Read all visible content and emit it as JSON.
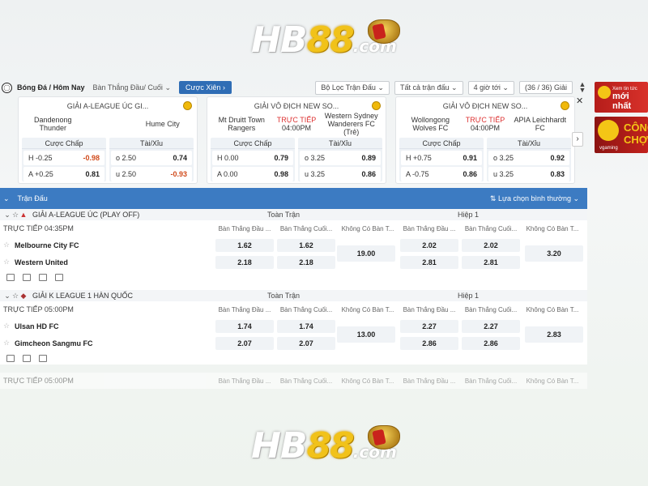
{
  "logo": {
    "hb": "HB",
    "n88": "88",
    "com": ".com"
  },
  "filterbar": {
    "breadcrumb": "Bóng Đá / Hôm Nay",
    "market_select": "Bàn Thắng Đầu/ Cuối",
    "xien_button": "Cược Xiên",
    "match_filter": "Bộ Lọc Trận Đấu",
    "all_matches": "Tất cả trận đấu",
    "time_filter": "4 giờ tới",
    "count": "(36 / 36) Giải"
  },
  "cards": [
    {
      "league": "GIẢI A-LEAGUE ÚC GI...",
      "home": "Dandenong Thunder",
      "away": "Hume City",
      "live": "",
      "time": "",
      "handicap_header": "Cược Chấp",
      "ou_header": "Tài/Xỉu",
      "h_line": "-0.25",
      "h_odd": "-0.98",
      "h_odd_neg": true,
      "a_line": "+0.25",
      "a_odd": "0.81",
      "a_odd_neg": false,
      "o_line": "2.50",
      "o_odd": "0.74",
      "o_odd_neg": false,
      "u_line": "2.50",
      "u_odd": "-0.93",
      "u_odd_neg": true
    },
    {
      "league": "GIẢI VÔ ĐỊCH NEW SO...",
      "home": "Mt Druitt Town Rangers",
      "away": "Western Sydney Wanderers FC (Trẻ)",
      "live": "TRỰC TIẾP",
      "time": "04:00PM",
      "handicap_header": "Cược Chấp",
      "ou_header": "Tài/Xỉu",
      "h_line": "0.00",
      "h_odd": "0.79",
      "h_odd_neg": false,
      "a_line": "0.00",
      "a_odd": "0.98",
      "a_odd_neg": false,
      "o_line": "3.25",
      "o_odd": "0.89",
      "o_odd_neg": false,
      "u_line": "3.25",
      "u_odd": "0.86",
      "u_odd_neg": false
    },
    {
      "league": "GIẢI VÔ ĐỊCH NEW SO...",
      "home": "Wollongong Wolves FC",
      "away": "APIA Leichhardt FC",
      "live": "TRỰC TIẾP",
      "time": "04:00PM",
      "handicap_header": "Cược Chấp",
      "ou_header": "Tài/Xỉu",
      "h_line": "+0.75",
      "h_odd": "0.91",
      "h_odd_neg": false,
      "a_line": "-0.75",
      "a_odd": "0.86",
      "a_odd_neg": false,
      "o_line": "3.25",
      "o_odd": "0.92",
      "o_odd_neg": false,
      "u_line": "3.25",
      "u_odd": "0.83",
      "u_odd_neg": false
    }
  ],
  "ads": {
    "a1_small": "Xem tin tức",
    "a1_big": "mới nhất",
    "a2_big": "CÔNG CHỢ",
    "a2_brand": "vgaming"
  },
  "table": {
    "header_label": "Trận Đấu",
    "sort_label": "Lựa chọn bình thường",
    "full_match": "Toàn Trận",
    "half1": "Hiệp 1",
    "col_first": "Bàn Thắng Đầu ...",
    "col_last": "Bàn Thắng Cuối...",
    "col_none": "Không Có Bàn T...",
    "leagues": [
      {
        "name": "GIẢI A-LEAGUE ÚC (PLAY OFF)",
        "status": "TRỰC TIẾP 04:35PM",
        "home": "Melbourne City FC",
        "away": "Western United",
        "home_first": "1.62",
        "home_last": "1.62",
        "away_first": "2.18",
        "away_last": "2.18",
        "none_full": "19.00",
        "home_first_h1": "2.02",
        "home_last_h1": "2.02",
        "away_first_h1": "2.81",
        "away_last_h1": "2.81",
        "none_h1": "3.20"
      },
      {
        "name": "GIẢI K LEAGUE 1 HÀN QUỐC",
        "status": "TRỰC TIẾP 05:00PM",
        "home": "Ulsan HD FC",
        "away": "Gimcheon Sangmu FC",
        "home_first": "1.74",
        "home_last": "1.74",
        "away_first": "2.07",
        "away_last": "2.07",
        "none_full": "13.00",
        "home_first_h1": "2.27",
        "home_last_h1": "2.27",
        "away_first_h1": "2.86",
        "away_last_h1": "2.86",
        "none_h1": "2.83"
      }
    ],
    "next_status": "TRỰC TIẾP 05:00PM"
  }
}
